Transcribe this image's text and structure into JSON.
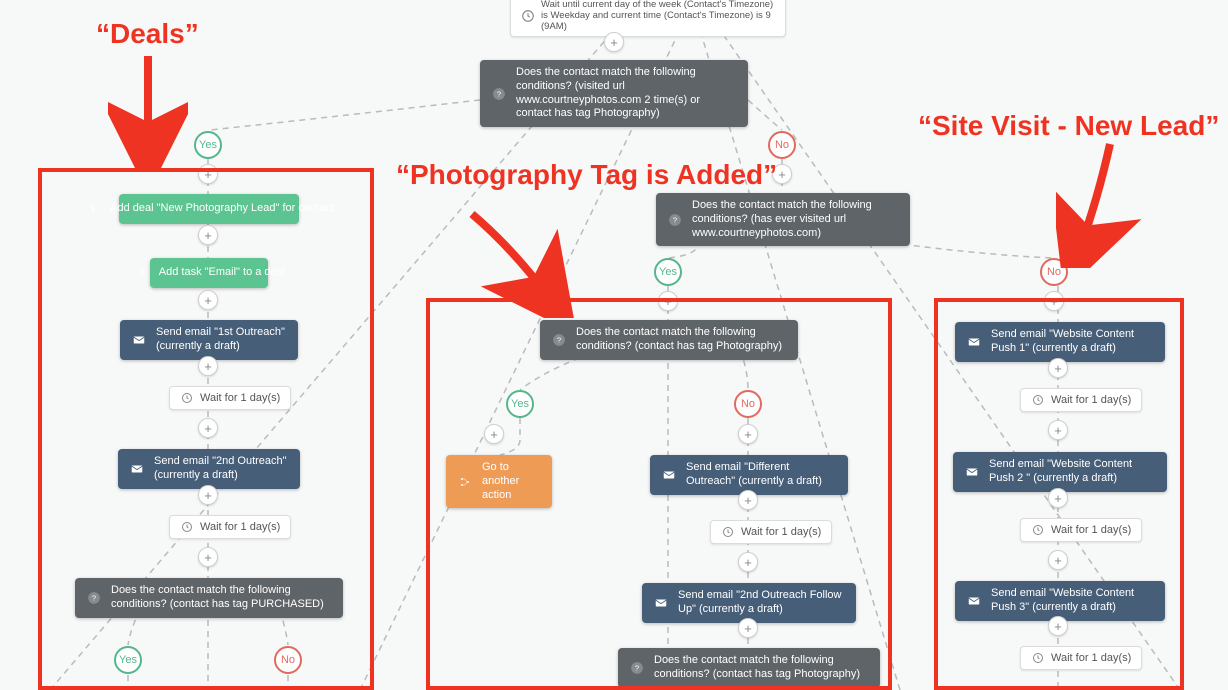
{
  "annotations": {
    "deals": "“Deals”",
    "photo": "“Photography Tag is Added”",
    "sitevisit": "“Site Visit - New Lead”"
  },
  "labels": {
    "yes": "Yes",
    "no": "No",
    "plus": "+"
  },
  "nodes": {
    "topWait": "Wait until current day of the week (Contact's Timezone) is Weekday and current time (Contact's Timezone) is 9 (9AM)",
    "topCond": "Does the contact match the following conditions? (visited url www.courtneyphotos.com 2 time(s) or contact has tag Photography)",
    "midCond": "Does the contact match the following conditions? (has ever visited url www.courtneyphotos.com)",
    "deal1": "Add deal \"New Photography Lead\" for contact",
    "deal2": "Add task \"Email\" to a deal",
    "email1": "Send email \"1st Outreach\" (currently a draft)",
    "wait1d": "Wait for 1 day(s)",
    "email2": "Send email \"2nd Outreach\" (currently a draft)",
    "condPurchased": "Does the contact match the following conditions? (contact has tag PURCHASED)",
    "condPhoto": "Does the contact match the following conditions? (contact has tag Photography)",
    "goto": "Go to another action",
    "emailDiff": "Send email \"Different Outreach\" (currently a draft)",
    "emailFollow": "Send email \"2nd Outreach Follow Up\" (currently a draft)",
    "condPhoto2": "Does the contact match the following conditions? (contact has tag Photography)",
    "emailPush1": "Send email \"Website Content Push 1\" (currently a draft)",
    "emailPush2": "Send email \"Website Content Push 2 \" (currently a draft)",
    "emailPush3": "Send email \"Website Content Push 3\" (currently a draft)"
  }
}
